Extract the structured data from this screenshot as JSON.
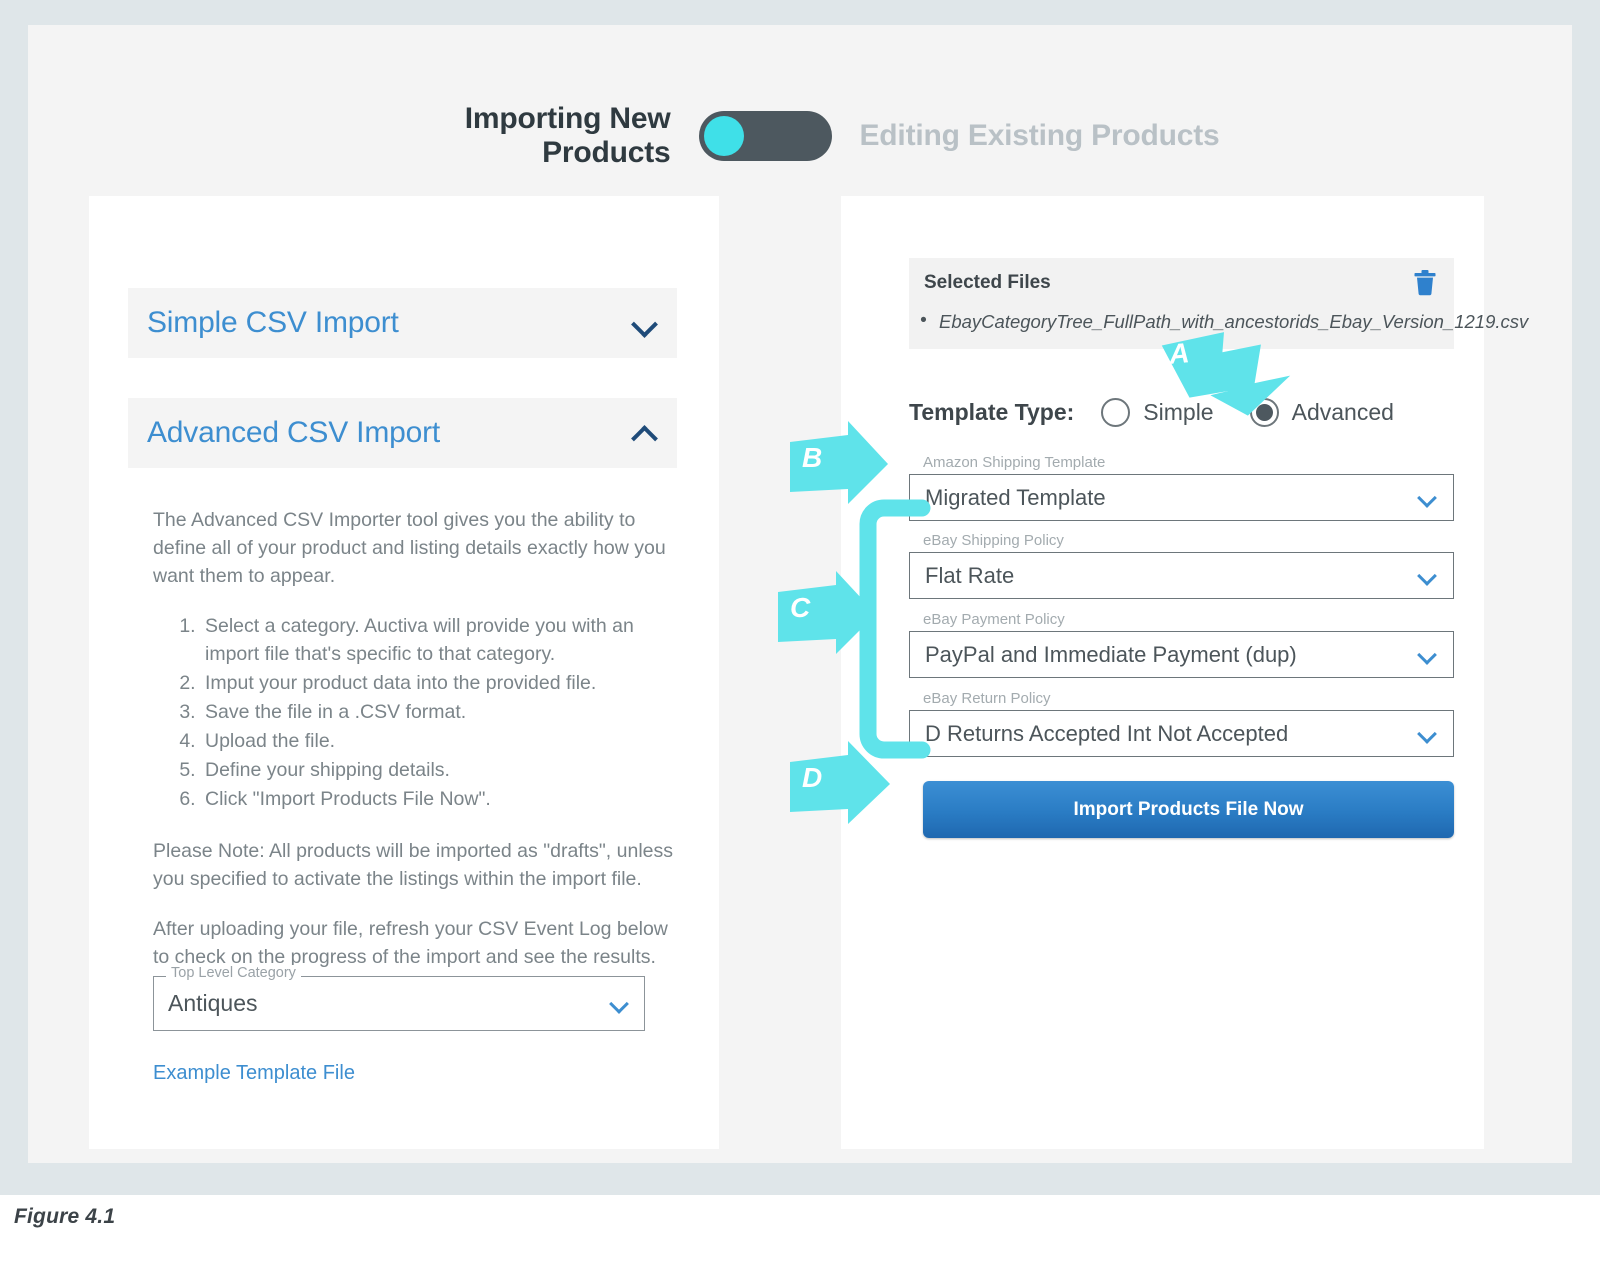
{
  "figure": {
    "caption": "Figure 4.1"
  },
  "mode_toggle": {
    "left_label": "Importing New Products",
    "right_label": "Editing Existing Products",
    "state": "left",
    "knob_color": "#3fe0e8",
    "track_color": "#4d585f"
  },
  "left_panel": {
    "accordion": [
      {
        "title": "Simple CSV Import",
        "icon": "chevron-down-icon",
        "expanded": false
      },
      {
        "title": "Advanced CSV Import",
        "icon": "chevron-up-icon",
        "expanded": true
      }
    ],
    "intro": "The Advanced CSV Importer tool gives you the ability to define all of your product and listing details exactly how you want them to appear.",
    "steps": [
      "Select a category. Auctiva will provide you with an import file that's specific to that category.",
      "Imput your product data into the provided file.",
      "Save the file in a .CSV format.",
      "Upload the file.",
      "Define your shipping details.",
      "Click \"Import Products File Now\"."
    ],
    "note_1": "Please Note: All products will be imported as \"drafts\", unless you specified to activate the listings within the import file.",
    "note_2": "After uploading your file, refresh your CSV Event Log below to check on the progress of the import and see the results.",
    "top_level_category": {
      "label": "Top Level Category",
      "value": "Antiques",
      "icon": "chevron-down-icon"
    },
    "example_link": "Example Template File"
  },
  "right_panel": {
    "selected_files": {
      "title": "Selected Files",
      "delete_icon": "trash-icon",
      "files": [
        "EbayCategoryTree_FullPath_with_ancestorids_Ebay_Version_1219.csv"
      ]
    },
    "template_type": {
      "label": "Template Type:",
      "options": [
        {
          "label": "Simple",
          "selected": false
        },
        {
          "label": "Advanced",
          "selected": true
        }
      ]
    },
    "fields": [
      {
        "label": "Amazon Shipping Template",
        "value": "Migrated Template",
        "icon": "chevron-down-icon"
      },
      {
        "label": "eBay Shipping Policy",
        "value": "Flat Rate",
        "icon": "chevron-down-icon"
      },
      {
        "label": "eBay Payment Policy",
        "value": "PayPal and Immediate Payment (dup)",
        "icon": "chevron-down-icon"
      },
      {
        "label": "eBay Return Policy",
        "value": "D Returns Accepted Int Not Accepted",
        "icon": "chevron-down-icon"
      }
    ],
    "import_button": "Import Products File Now"
  },
  "annotations": {
    "color": "#5fe3ea",
    "markers": [
      {
        "letter": "A",
        "target": "advanced-radio"
      },
      {
        "letter": "B",
        "target": "amazon-shipping-template-field"
      },
      {
        "letter": "C",
        "target": "ebay-policy-fields-group"
      },
      {
        "letter": "D",
        "target": "import-products-button"
      }
    ]
  },
  "colors": {
    "frame": "#dfe6e9",
    "app_background": "#f4f4f4",
    "card": "#ffffff",
    "accent_blue": "#3d8ed0",
    "button_blue": "#2a7cc4",
    "cyan": "#5fe3ea",
    "text_muted": "#7b8489"
  }
}
